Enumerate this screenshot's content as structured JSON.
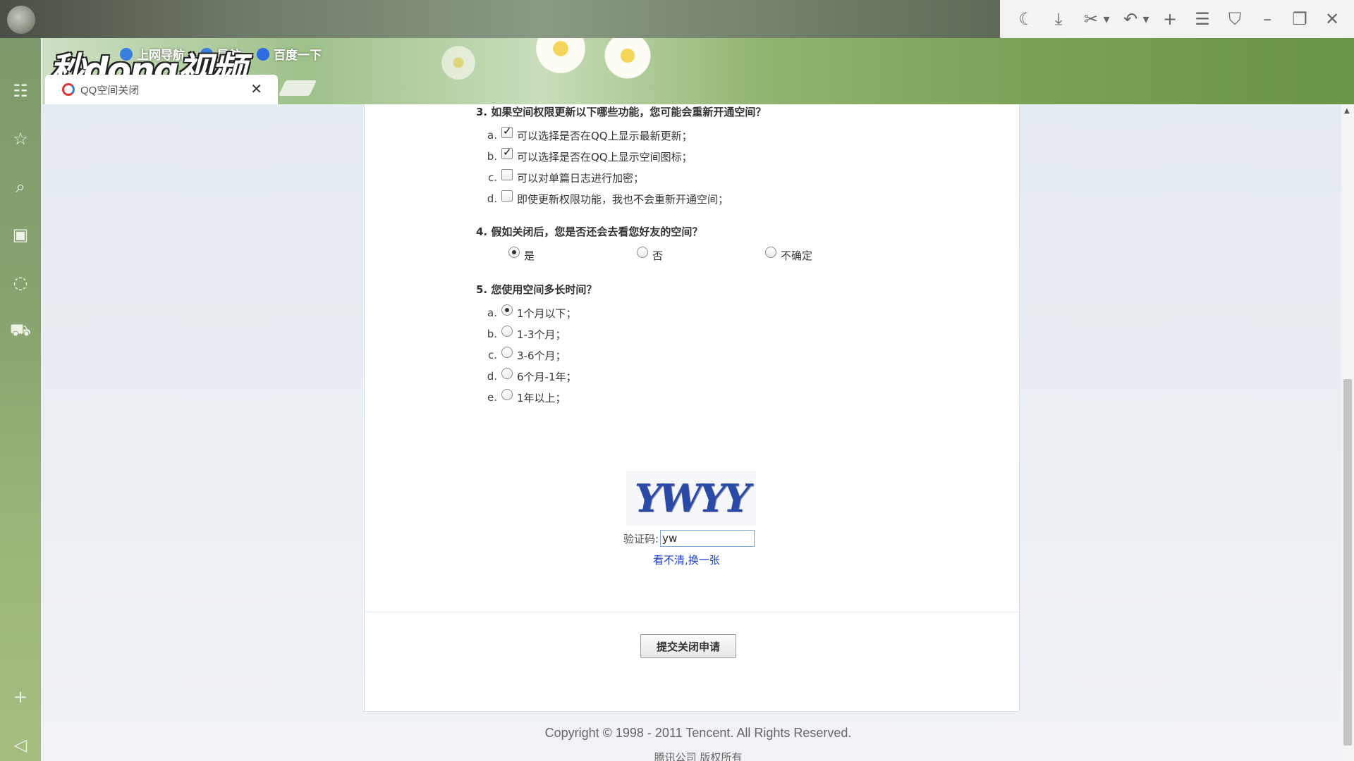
{
  "browser": {
    "tab_title": "QQ空间关闭",
    "tab_close": "✕",
    "bookmarks": [
      "上网导航",
      "导航",
      "百度一下"
    ],
    "watermark": "秒dong视频",
    "window_icons": [
      "moon-icon",
      "download-icon",
      "scissors-icon",
      "undo-icon",
      "plus-icon",
      "menu-icon",
      "shirt-icon",
      "minimize-icon",
      "restore-icon",
      "close-icon"
    ]
  },
  "sidebar": {
    "icons": [
      "news-icon",
      "star-icon",
      "search-icon",
      "video-icon",
      "chat-icon",
      "cart-icon",
      "add-icon",
      "collapse-icon"
    ]
  },
  "survey": {
    "q3": {
      "title": "3. 如果空间权限更新以下哪些功能，您可能会重新开通空间？",
      "options": [
        {
          "letter": "a.",
          "label": "可以选择是否在QQ上显示最新更新；",
          "checked": true
        },
        {
          "letter": "b.",
          "label": "可以选择是否在QQ上显示空间图标；",
          "checked": true
        },
        {
          "letter": "c.",
          "label": "可以对单篇日志进行加密；",
          "checked": false
        },
        {
          "letter": "d.",
          "label": "即使更新权限功能，我也不会重新开通空间；",
          "checked": false
        }
      ]
    },
    "q4": {
      "title": "4. 假如关闭后，您是否还会去看您好友的空间？",
      "options": [
        {
          "label": "是",
          "selected": true
        },
        {
          "label": "否",
          "selected": false
        },
        {
          "label": "不确定",
          "selected": false
        }
      ]
    },
    "q5": {
      "title": "5. 您使用空间多长时间？",
      "options": [
        {
          "letter": "a.",
          "label": "1个月以下；",
          "selected": true
        },
        {
          "letter": "b.",
          "label": "1-3个月；",
          "selected": false
        },
        {
          "letter": "c.",
          "label": "3-6个月；",
          "selected": false
        },
        {
          "letter": "d.",
          "label": "6个月-1年；",
          "selected": false
        },
        {
          "letter": "e.",
          "label": "1年以上；",
          "selected": false
        }
      ]
    }
  },
  "captcha": {
    "image_text": "YWYY",
    "label": "验证码:",
    "value": "yw",
    "refresh_link": "看不清,换一张"
  },
  "submit_label": "提交关闭申请",
  "footer": {
    "copyright": "Copyright © 1998 - 2011 Tencent. All Rights Reserved.",
    "company": "腾讯公司 版权所有"
  }
}
